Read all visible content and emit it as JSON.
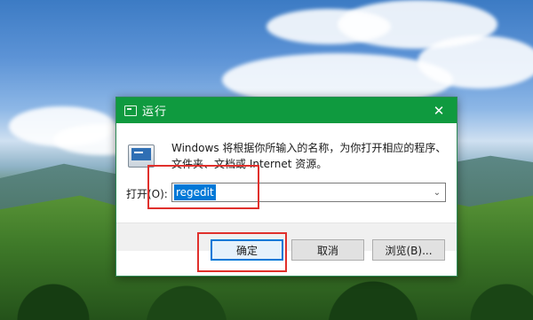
{
  "dialog": {
    "title": "运行",
    "close_glyph": "✕",
    "description": "Windows 将根据你所输入的名称，为你打开相应的程序、文件夹、文档或 Internet 资源。",
    "open_label": "打开(O):",
    "open_value": "regedit",
    "dropdown_glyph": "⌄"
  },
  "buttons": {
    "ok": "确定",
    "cancel": "取消",
    "browse": "浏览(B)..."
  },
  "colors": {
    "titlebar": "#0f9a3f",
    "selection": "#0078d7",
    "annotation": "#e0302c"
  },
  "icons": {
    "title": "run-icon",
    "app": "run-app-icon",
    "close": "close-icon",
    "dropdown": "chevron-down-icon"
  }
}
